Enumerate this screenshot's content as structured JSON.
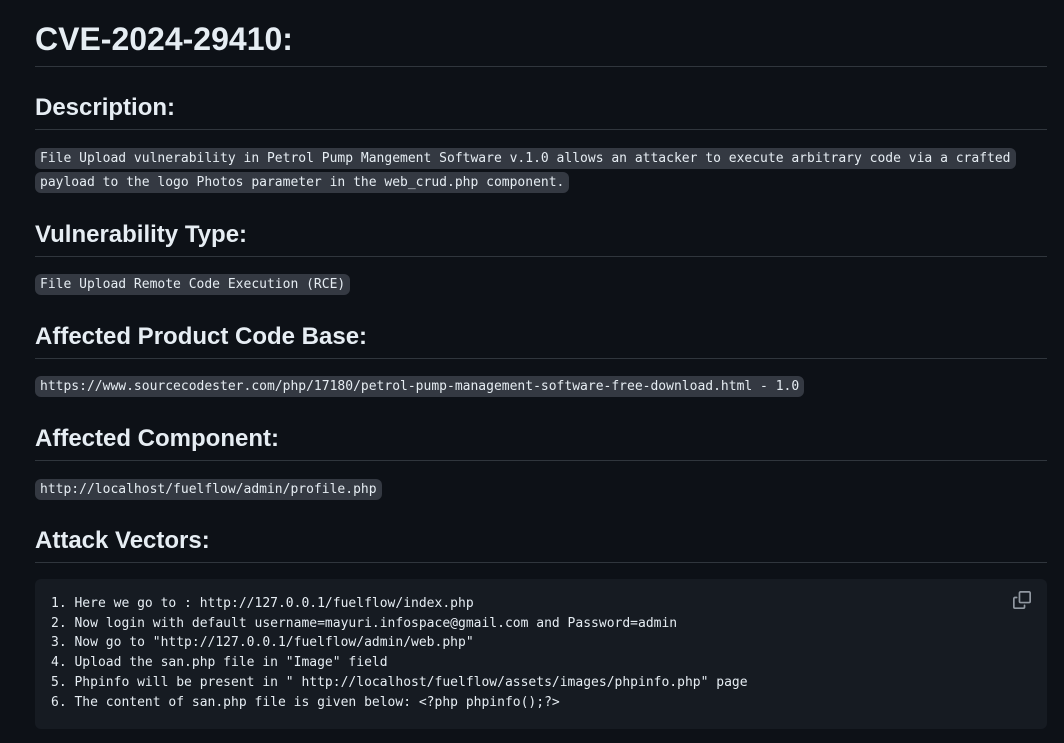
{
  "title": "CVE-2024-29410:",
  "sections": {
    "description": {
      "heading": "Description:",
      "text": "File Upload vulnerability in Petrol Pump Mangement Software v.1.0 allows an attacker to execute arbitrary code via a crafted payload to the logo Photos parameter in the web_crud.php component."
    },
    "vuln_type": {
      "heading": "Vulnerability Type:",
      "text": "File Upload Remote Code Execution (RCE)"
    },
    "product": {
      "heading": "Affected Product Code Base:",
      "text": "https://www.sourcecodester.com/php/17180/petrol-pump-management-software-free-download.html - 1.0"
    },
    "component": {
      "heading": "Affected Component:",
      "text": "http://localhost/fuelflow/admin/profile.php"
    },
    "attack_vectors": {
      "heading": "Attack Vectors:",
      "lines": [
        "1. Here we go to : http://127.0.0.1/fuelflow/index.php",
        "2. Now login with default username=mayuri.infospace@gmail.com and Password=admin",
        "3. Now go to \"http://127.0.0.1/fuelflow/admin/web.php\"",
        "4. Upload the san.php file in \"Image\" field",
        "5. Phpinfo will be present in \" http://localhost/fuelflow/assets/images/phpinfo.php\" page",
        "6. The content of san.php file is given below: <?php phpinfo();?>"
      ],
      "copy_icon": "copy-icon"
    }
  }
}
